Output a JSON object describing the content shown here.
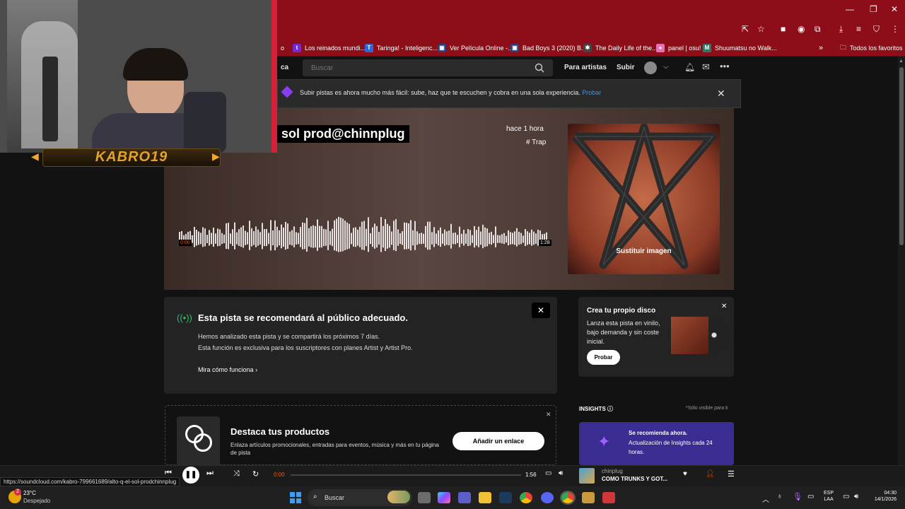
{
  "browser": {
    "bookmarks": [
      {
        "label": "Los reinados mundi...",
        "fav_color": "#6e2bd6",
        "fav_glyph": "t"
      },
      {
        "label": "Taringa! - Inteligenc...",
        "fav_color": "#2c69d6",
        "fav_glyph": "T"
      },
      {
        "label": "Ver Película Online -...",
        "fav_color": "#2d3f7a",
        "fav_glyph": "▣"
      },
      {
        "label": "Bad Boys 3 (2020) B...",
        "fav_color": "#2d3f7a",
        "fav_glyph": "▣"
      },
      {
        "label": "The Daily Life of the...",
        "fav_color": "#444444",
        "fav_glyph": "✱"
      },
      {
        "label": "panel | osu!",
        "fav_color": "#e96fb0",
        "fav_glyph": "●"
      },
      {
        "label": "Shuumatsu no Walk...",
        "fav_color": "#2d7a6b",
        "fav_glyph": "M"
      }
    ],
    "bookmarks_overflow": "»",
    "all_favorites": "Todos los favoritos",
    "partial_bookmark": "o"
  },
  "header": {
    "partial_home": "ca",
    "search_placeholder": "Buscar",
    "for_artists": "Para artistas",
    "upload": "Subir"
  },
  "banner": {
    "text": "Subir pistas es ahora mucho más fácil: sube, haz que te escuchen y cobra en una sola experiencia.",
    "link": "Probar"
  },
  "track": {
    "title": "sol prod@chinnplug",
    "time_ago": "hace 1 hora",
    "tag": "# Trap",
    "replace_image": "Sustituir imagen",
    "time_start": "0:00",
    "time_end": "1:28"
  },
  "promo": {
    "title": "Esta pista se recomendará al público adecuado.",
    "line1": "Hemos analizado esta pista y se compartirá los próximos 7 días.",
    "line2": "Esta función es exclusiva para los suscriptores con planes Artist y Artist Pro.",
    "link": "Mira cómo funciona"
  },
  "vinyl": {
    "title": "Crea tu propio disco",
    "text": "Lanza esta pista en vinilo, bajo demanda y sin coste inicial.",
    "button": "Probar"
  },
  "destaca": {
    "title": "Destaca tus productos",
    "text": "Enlaza artículos promocionales, entradas para eventos, música y más en tu página de pista",
    "button": "Añadir un enlace"
  },
  "insights": {
    "label": "INSIGHTS",
    "note": "*Sólo visible para ti",
    "card_title": "Se recomienda ahora.",
    "card_text": "Actualización de Insights cada 24 horas."
  },
  "player": {
    "current_time": "0:00",
    "duration": "1:56",
    "progress": 0,
    "artist": "chinplug",
    "track": "COMO TRUNKS Y GOT..."
  },
  "status_url": "https://soundcloud.com/kabro-799661689/alto-q-el-sol-prodchinnplug",
  "taskbar": {
    "weather_temp": "23°C",
    "weather_desc": "Despejado",
    "search": "Buscar",
    "lang": "ESP",
    "lang_sub": "LAA",
    "time": "04:30",
    "date": "14/1/2026",
    "weather_badge": "2"
  },
  "webcam": {
    "label": "KABRO19"
  },
  "colors": {
    "browser_red": "#8d0e18",
    "accent_orange": "#ff5500",
    "insights_purple": "#3a2d92",
    "link_blue": "#4a90e2"
  }
}
